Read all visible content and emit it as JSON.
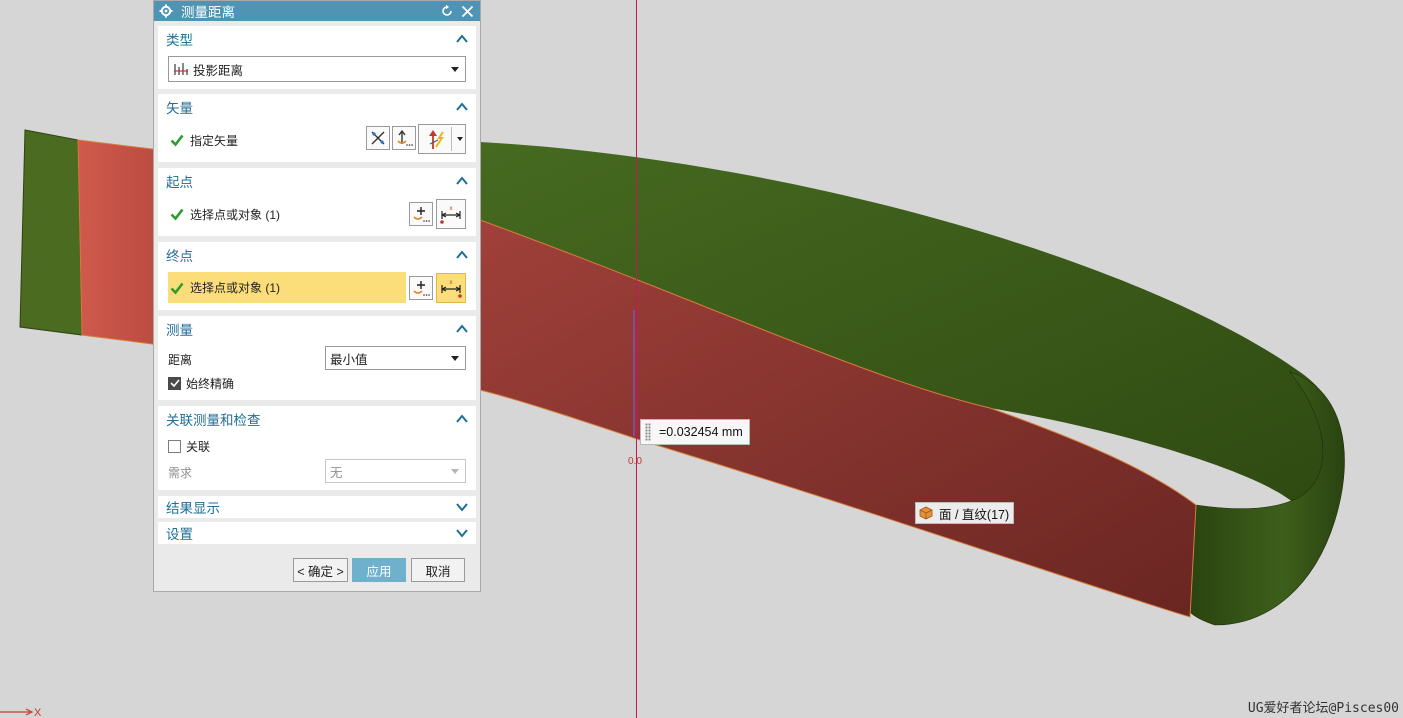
{
  "dialog": {
    "title": "测量距离",
    "sections": {
      "type": {
        "title": "类型",
        "dropdown_value": "投影距离"
      },
      "vector": {
        "title": "矢量",
        "item_label": "指定矢量"
      },
      "start": {
        "title": "起点",
        "item_label": "选择点或对象 (1)"
      },
      "end": {
        "title": "终点",
        "item_label": "选择点或对象 (1)"
      },
      "measure": {
        "title": "测量",
        "distance_label": "距离",
        "distance_value": "最小值",
        "always_accurate_label": "始终精确",
        "always_accurate_checked": true
      },
      "associative": {
        "title": "关联测量和检查",
        "associate_label": "关联",
        "associate_checked": false,
        "requirement_label": "需求",
        "requirement_value": "无"
      },
      "results": {
        "title": "结果显示"
      },
      "settings": {
        "title": "设置"
      }
    },
    "buttons": {
      "ok": "< 确定 >",
      "apply": "应用",
      "cancel": "取消"
    }
  },
  "viewport": {
    "measurement_value": "=0.032454 mm",
    "zero_label": "0.0",
    "face_tooltip": "面 / 直纹(17)",
    "axis_label": "X",
    "watermark": "UG爱好者论坛@Pisces00"
  },
  "colors": {
    "title_bar": "#4f95b3",
    "section_title": "#1f6e95",
    "highlight_row": "#fbde7a",
    "apply_button": "#6fb0cc",
    "green_surface": "#3e5f1c",
    "red_surface": "#8e3530",
    "measure_line": "#c2185b"
  }
}
